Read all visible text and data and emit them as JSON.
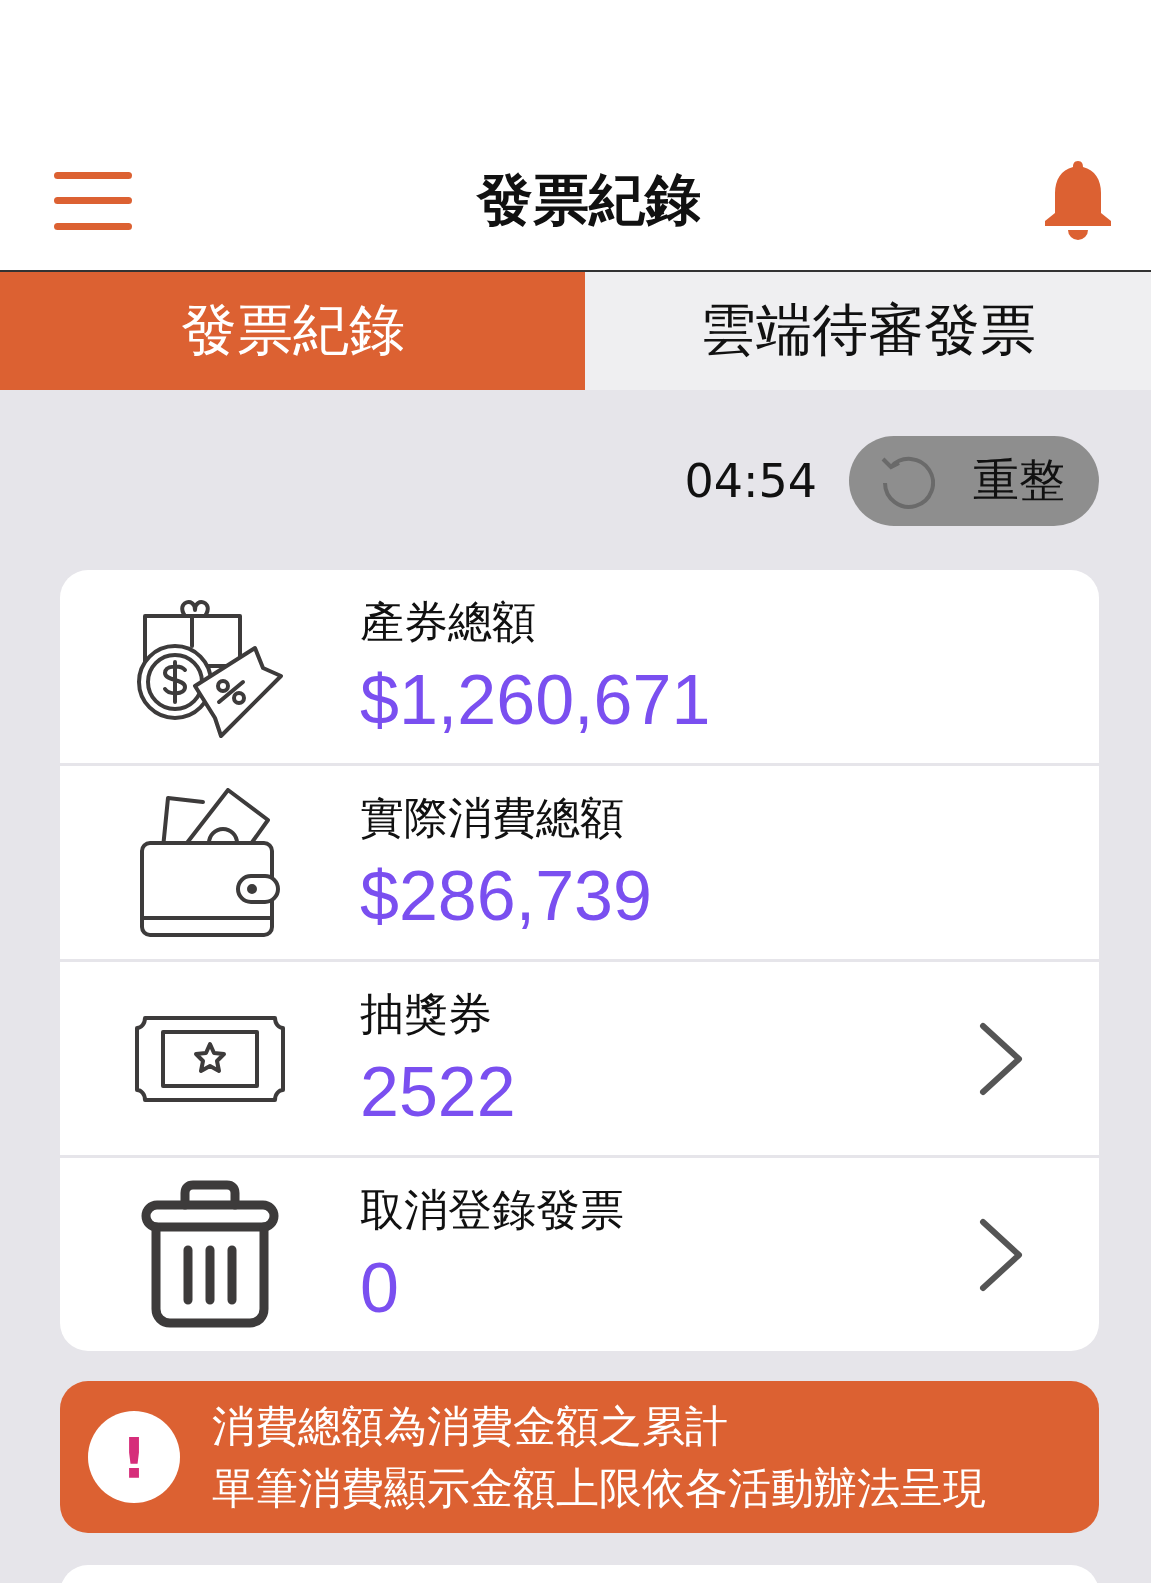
{
  "header": {
    "title": "發票紀錄"
  },
  "tabs": [
    {
      "label": "發票紀錄",
      "selected": true
    },
    {
      "label": "雲端待審發票",
      "selected": false
    }
  ],
  "refresh": {
    "countdown": "04:54",
    "label": "重整"
  },
  "summary": [
    {
      "kind": "coupon",
      "label": "產券總額",
      "value": "$1,260,671",
      "chevron": false
    },
    {
      "kind": "wallet",
      "label": "實際消費總額",
      "value": "$286,739",
      "chevron": false
    },
    {
      "kind": "ticket",
      "label": "抽獎券",
      "value": "2522",
      "chevron": true
    },
    {
      "kind": "trash",
      "label": "取消登錄發票",
      "value": "0",
      "chevron": true
    }
  ],
  "notice": {
    "symbol": "!",
    "lines": [
      "消費總額為消費金額之累計",
      "單筆消費顯示金額上限依各活動辦法呈現"
    ]
  }
}
